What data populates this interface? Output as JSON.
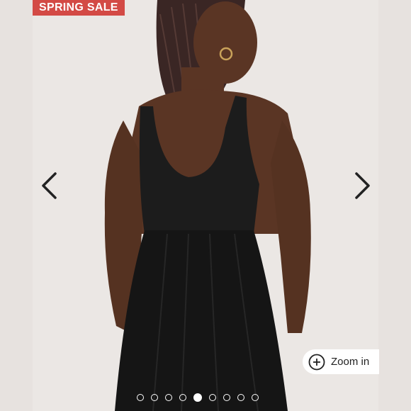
{
  "badge": {
    "label": "SPRING SALE",
    "color": "#d34a45"
  },
  "navigation": {
    "prev_icon": "chevron-left-icon",
    "next_icon": "chevron-right-icon"
  },
  "zoom": {
    "label": "Zoom in",
    "icon": "plus-circle-icon"
  },
  "carousel": {
    "total_images": 9,
    "active_index": 4
  }
}
